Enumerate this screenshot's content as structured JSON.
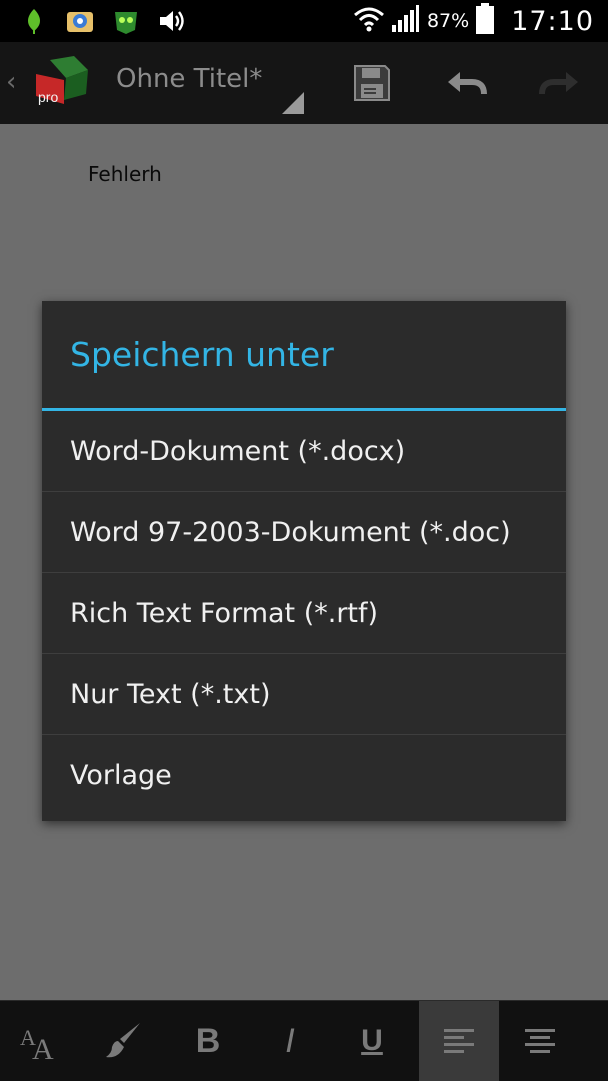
{
  "status_bar": {
    "battery_percent": "87%",
    "time": "17:10",
    "icons": [
      "leaf-icon",
      "photo-app-icon",
      "game-app-icon",
      "volume-icon",
      "wifi-icon",
      "signal-icon",
      "battery-icon"
    ]
  },
  "action_bar": {
    "title": "Ohne Titel*",
    "logo_badge": "pro",
    "buttons": [
      "save-icon",
      "undo-icon",
      "redo-icon"
    ]
  },
  "document": {
    "text": "Fehlerh"
  },
  "dialog": {
    "title": "Speichern unter",
    "accent_color": "#33b5e5",
    "items": [
      {
        "label": "Word-Dokument (*.docx)"
      },
      {
        "label": "Word 97-2003-Dokument (*.doc)"
      },
      {
        "label": "Rich Text Format (*.rtf)"
      },
      {
        "label": "Nur Text (*.txt)"
      },
      {
        "label": "Vorlage"
      }
    ]
  },
  "toolbar": {
    "bold_label": "B",
    "italic_label": "I",
    "underline_label": "U",
    "active": "align-left",
    "icons": [
      "font-size-icon",
      "paint-brush-icon",
      "bold-icon",
      "italic-icon",
      "underline-icon",
      "align-left-icon",
      "align-center-icon"
    ]
  }
}
